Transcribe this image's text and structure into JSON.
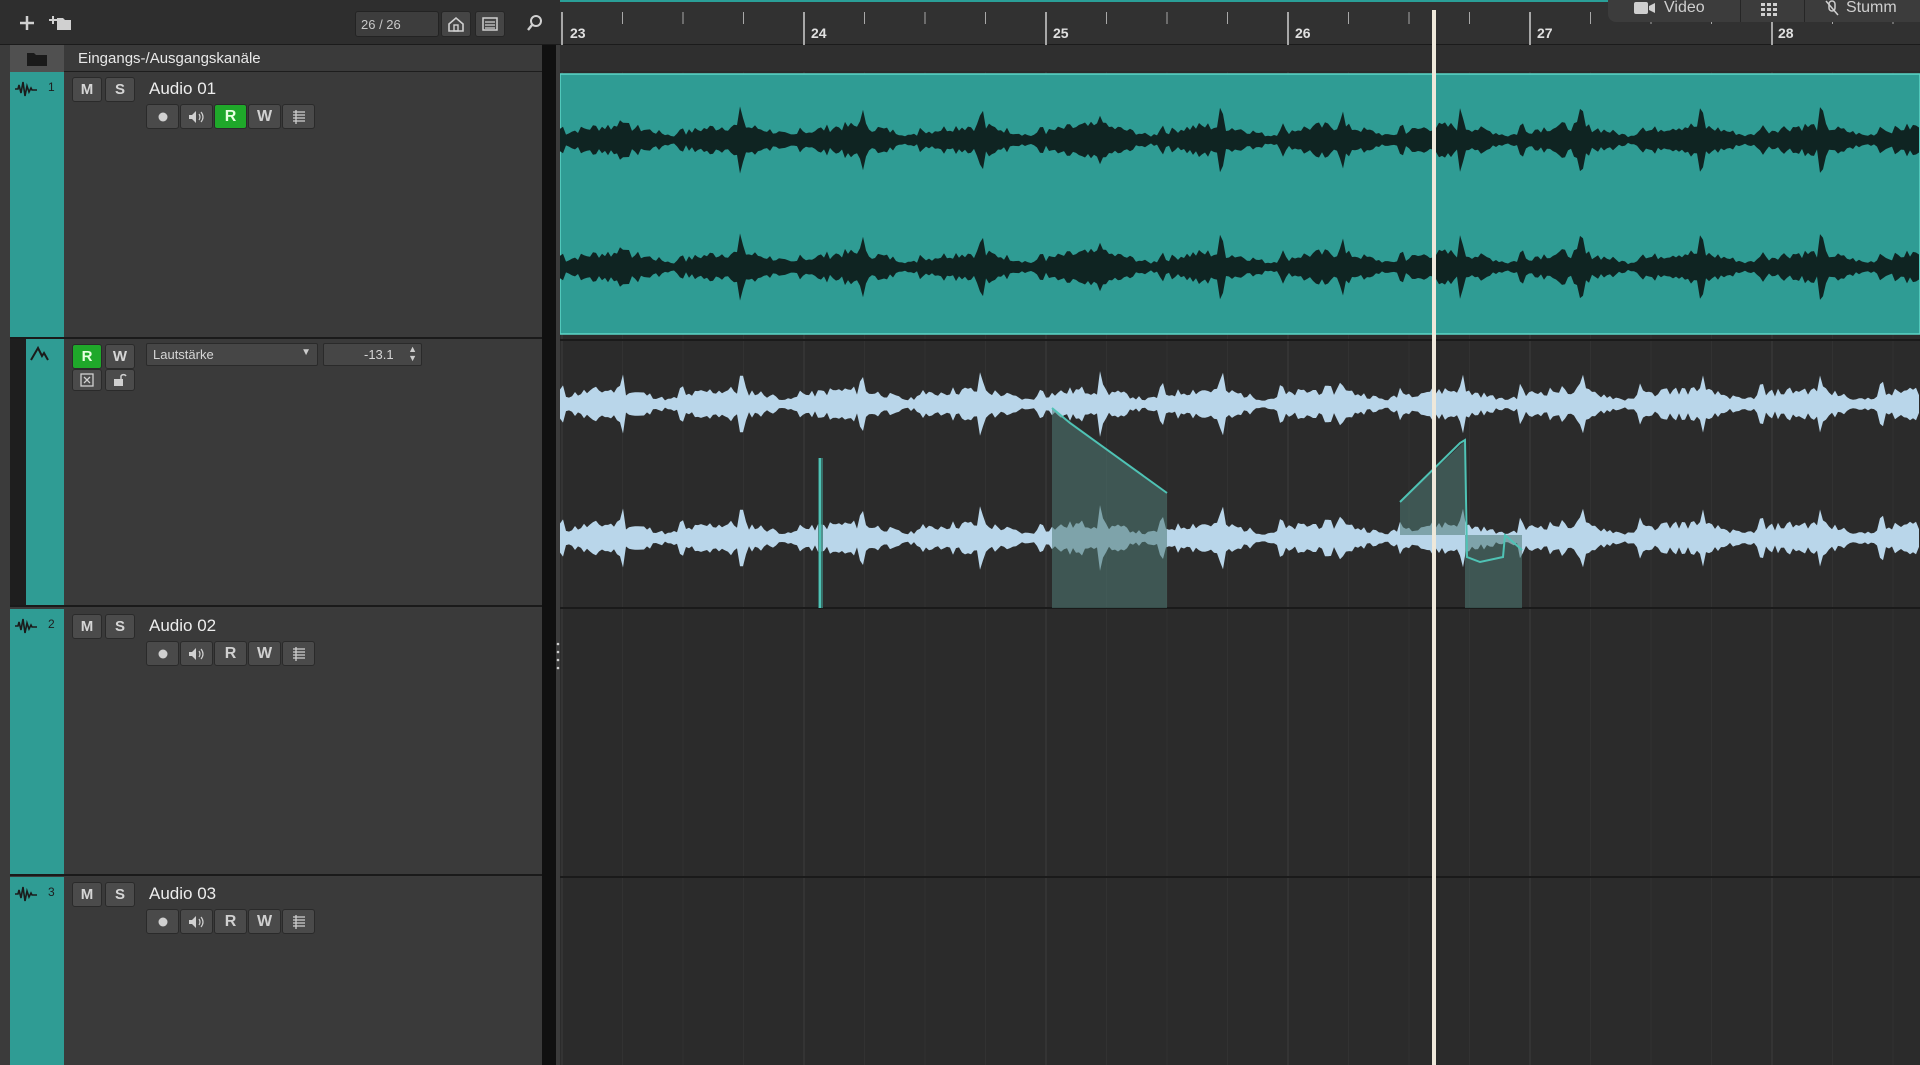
{
  "toolbar": {
    "add_icon": "plus-icon",
    "add_folder_icon": "add-folder-icon",
    "counter": "26 / 26",
    "home_icon": "home-icon",
    "list_icon": "list-icon",
    "search_icon": "search-icon"
  },
  "io_row": {
    "label": "Eingangs-/Ausgangskanäle",
    "icon": "folder-icon"
  },
  "tracks": [
    {
      "number": "1",
      "name": "Audio 01",
      "mute": "M",
      "solo": "S",
      "read": "R",
      "write": "W",
      "read_active": true
    },
    {
      "number": "2",
      "name": "Audio 02",
      "mute": "M",
      "solo": "S",
      "read": "R",
      "write": "W",
      "read_active": false
    },
    {
      "number": "3",
      "name": "Audio 03",
      "mute": "M",
      "solo": "S",
      "read": "R",
      "write": "W",
      "read_active": false
    }
  ],
  "automation": {
    "read": "R",
    "write": "W",
    "parameter": "Lautstärke",
    "value": "-13.1",
    "read_active": true
  },
  "ruler": {
    "bars": [
      "23",
      "24",
      "25",
      "26",
      "27",
      "28"
    ]
  },
  "top_panel": {
    "video": "Video",
    "mute": "Stumm"
  },
  "colors": {
    "track": "#2f9c94",
    "automation_curve": "#4fc3b5",
    "waveform_light": "#b9d6ea",
    "record_green": "#1fa82a",
    "playhead": "#eee8da"
  }
}
